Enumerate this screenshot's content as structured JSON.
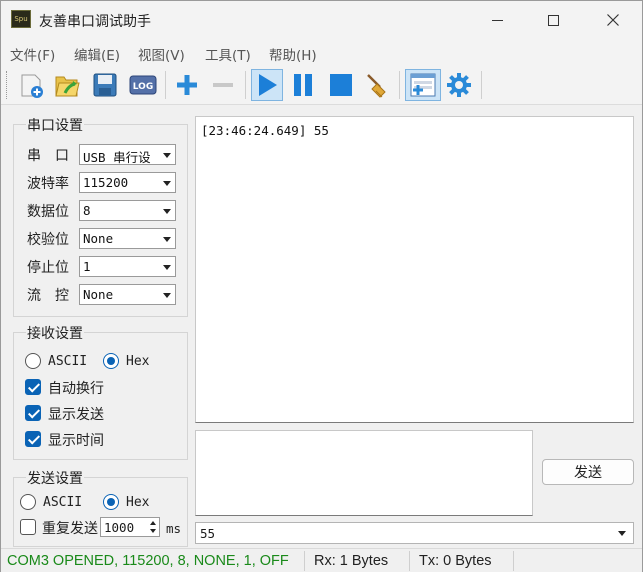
{
  "window": {
    "title": "友善串口调试助手",
    "icon_text": "Spu",
    "icons": {
      "minimize": "minimize-icon",
      "maximize": "maximize-icon",
      "close": "close-icon"
    }
  },
  "menu": [
    {
      "label": "文件(F)"
    },
    {
      "label": "编辑(E)"
    },
    {
      "label": "视图(V)"
    },
    {
      "label": "工具(T)"
    },
    {
      "label": "帮助(H)"
    }
  ],
  "toolbar": {
    "buttons": [
      {
        "icon": "new-icon"
      },
      {
        "icon": "open-icon"
      },
      {
        "icon": "save-icon"
      },
      {
        "icon": "log-icon",
        "text": "LOG"
      },
      {
        "icon": "add-icon"
      },
      {
        "icon": "remove-icon"
      },
      {
        "icon": "start-icon",
        "active": true
      },
      {
        "icon": "pause-icon"
      },
      {
        "icon": "stop-icon"
      },
      {
        "icon": "clear-icon"
      },
      {
        "icon": "window-layout-icon",
        "active": true
      },
      {
        "icon": "settings-icon"
      }
    ],
    "colors": {
      "blue": "#1c7fd8",
      "active_bg": "#cce4f7"
    }
  },
  "serial": {
    "title": "串口设置",
    "fields": [
      {
        "label": "串　口",
        "value": "USB 串行设"
      },
      {
        "label": "波特率",
        "value": "115200"
      },
      {
        "label": "数据位",
        "value": "8"
      },
      {
        "label": "校验位",
        "value": "None"
      },
      {
        "label": "停止位",
        "value": "1"
      },
      {
        "label": "流　控",
        "value": "None"
      }
    ]
  },
  "receive": {
    "title": "接收设置",
    "mode_ascii": "ASCII",
    "mode_hex": "Hex",
    "selected_mode": "Hex",
    "options": [
      {
        "label": "自动换行",
        "checked": true
      },
      {
        "label": "显示发送",
        "checked": true
      },
      {
        "label": "显示时间",
        "checked": true
      }
    ]
  },
  "send_settings": {
    "title": "发送设置",
    "mode_ascii": "ASCII",
    "mode_hex": "Hex",
    "selected_mode": "Hex",
    "repeat_label": "重复发送",
    "repeat_checked": false,
    "interval": "1000",
    "unit": "ms"
  },
  "receive_area": {
    "lines": [
      "[23:46:24.649] 55"
    ]
  },
  "send": {
    "text": "",
    "button_label": "发送",
    "history_value": "55"
  },
  "status": {
    "connection": "COM3 OPENED, 115200, 8, NONE, 1, OFF",
    "rx": "Rx: 1 Bytes",
    "tx": "Tx: 0 Bytes",
    "connection_color": "#1a8a1a"
  }
}
